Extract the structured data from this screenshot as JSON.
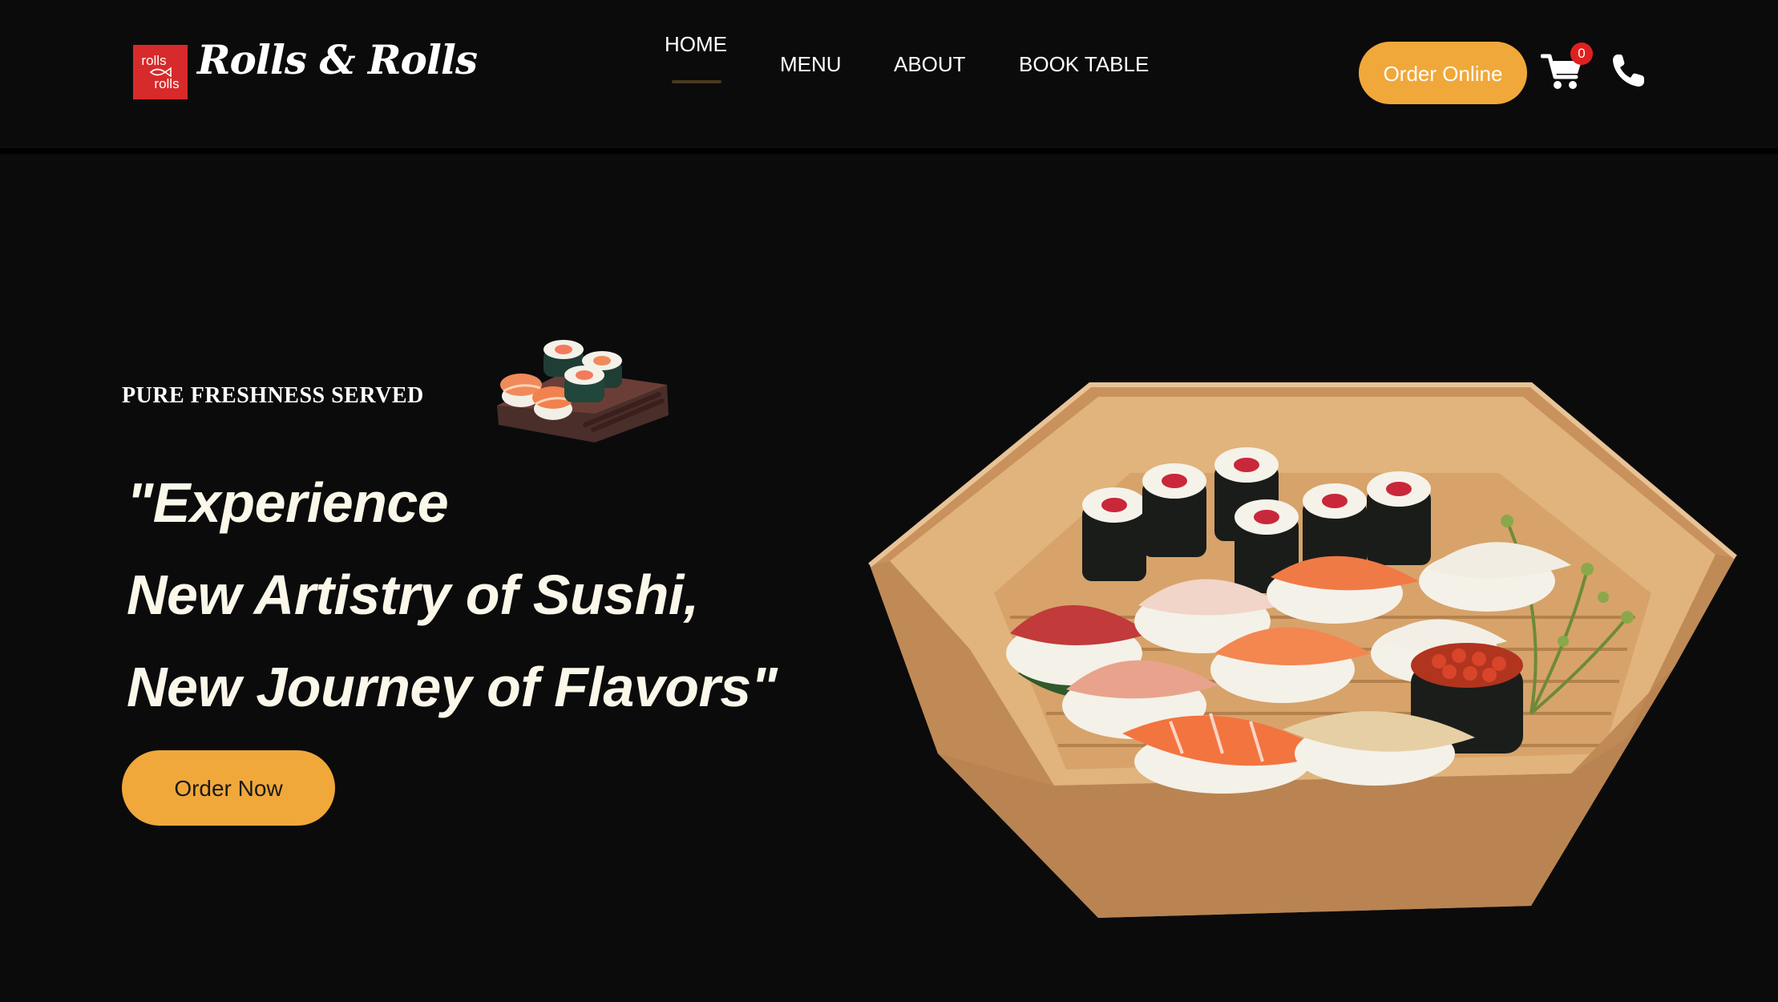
{
  "brand": {
    "logo_text_top": "rolls",
    "logo_text_bottom": "rolls",
    "name": "Rolls & Rolls",
    "logo_color": "#d72a2a"
  },
  "nav": {
    "items": [
      {
        "label": "HOME",
        "active": true
      },
      {
        "label": "MENU",
        "active": false
      },
      {
        "label": "ABOUT",
        "active": false
      },
      {
        "label": "BOOK TABLE",
        "active": false
      }
    ]
  },
  "header_actions": {
    "order_online_label": "Order Online",
    "cart_count": "0",
    "cart_icon": "shopping-cart-icon",
    "phone_icon": "phone-icon"
  },
  "hero": {
    "tagline": "PURE FRESHNESS SERVED",
    "headline_lines": [
      "\"Experience",
      "New Artistry of Sushi,",
      "New Journey of Flavors\""
    ],
    "cta_label": "Order Now",
    "tagline_image": "sushi-platter-small-image",
    "main_image": "sushi-boat-image"
  },
  "colors": {
    "background": "#0b0b0c",
    "accent": "#f0a83a",
    "badge": "#e02020",
    "headline_text": "#fbf8ea"
  }
}
